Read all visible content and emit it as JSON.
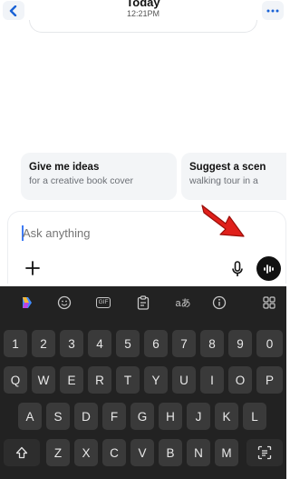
{
  "header": {
    "title": "Today",
    "time": "12:21PM"
  },
  "suggestions": [
    {
      "title": "Give me ideas",
      "subtitle": "for a creative book cover"
    },
    {
      "title": "Suggest a scen",
      "subtitle": "walking tour in a"
    }
  ],
  "composer": {
    "placeholder": "Ask anything"
  },
  "keyboard": {
    "toolbar": [
      "copilot-icon",
      "emoji-icon",
      "gif-icon",
      "clipboard-icon",
      "translate-icon",
      "info-icon",
      "layout-icon"
    ],
    "translate_label": "aあ",
    "gif_label": "GIF",
    "number_row": [
      "1",
      "2",
      "3",
      "4",
      "5",
      "6",
      "7",
      "8",
      "9",
      "0"
    ],
    "row1": [
      "Q",
      "W",
      "E",
      "R",
      "T",
      "Y",
      "U",
      "I",
      "O",
      "P"
    ],
    "row2": [
      "A",
      "S",
      "D",
      "F",
      "G",
      "H",
      "J",
      "K",
      "L"
    ],
    "row3": [
      "Z",
      "X",
      "C",
      "V",
      "B",
      "N",
      "M"
    ]
  },
  "colors": {
    "accent_arrow": "#e0201b",
    "keyboard_bg": "#222222",
    "key_bg": "#3a3a3a",
    "caret": "#3e7bf5"
  }
}
